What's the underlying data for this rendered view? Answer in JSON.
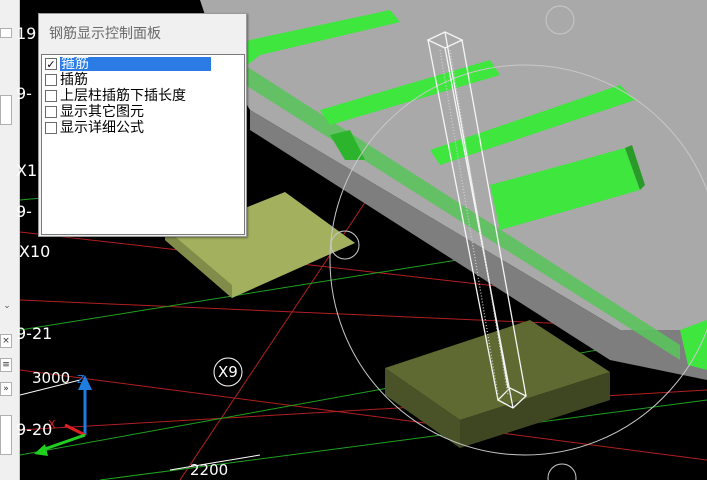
{
  "panel": {
    "title": "钢筋显示控制面板",
    "items": [
      {
        "label": "箍筋",
        "checked": true,
        "selected": true
      },
      {
        "label": "插筋",
        "checked": false,
        "selected": false
      },
      {
        "label": "上层柱插筋下插长度",
        "checked": false,
        "selected": false
      },
      {
        "label": "显示其它图元",
        "checked": false,
        "selected": false
      },
      {
        "label": "显示详细公式",
        "checked": false,
        "selected": false
      }
    ],
    "check_mark": "✓"
  },
  "left_strip": {
    "scroll_arrow": "⌄",
    "close_glyph": "×",
    "pin_glyph": "≡",
    "expand_glyph": "»"
  },
  "viewport": {
    "labels": {
      "axis_19_top": "19",
      "axis_9_a": "9-",
      "axis_x1": "X1",
      "axis_9_b": "9-",
      "axis_x10": "X10",
      "axis_9_21": "9-21",
      "dim_3000": "3000",
      "axis_x9": "X9",
      "axis_9_20": "9-20",
      "dim_2200": "2200"
    },
    "colors": {
      "rebar_green": "#3ee63e",
      "slab_gray": "#a9a9a9",
      "footing_light": "#a3b15f",
      "footing_dark": "#5f6a32",
      "grid_red": "#b02020",
      "grid_green": "#1fa01f"
    }
  }
}
